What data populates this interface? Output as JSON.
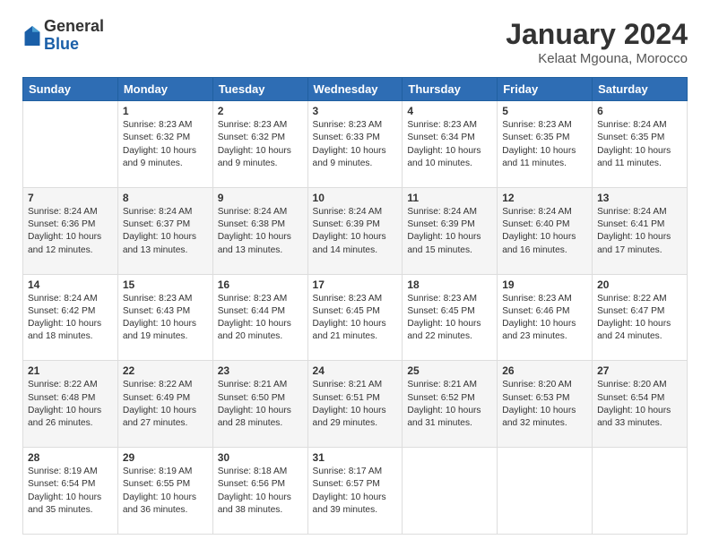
{
  "header": {
    "logo_general": "General",
    "logo_blue": "Blue",
    "month_title": "January 2024",
    "location": "Kelaat Mgouna, Morocco"
  },
  "weekdays": [
    "Sunday",
    "Monday",
    "Tuesday",
    "Wednesday",
    "Thursday",
    "Friday",
    "Saturday"
  ],
  "weeks": [
    [
      {
        "day": "",
        "info": ""
      },
      {
        "day": "1",
        "info": "Sunrise: 8:23 AM\nSunset: 6:32 PM\nDaylight: 10 hours\nand 9 minutes."
      },
      {
        "day": "2",
        "info": "Sunrise: 8:23 AM\nSunset: 6:32 PM\nDaylight: 10 hours\nand 9 minutes."
      },
      {
        "day": "3",
        "info": "Sunrise: 8:23 AM\nSunset: 6:33 PM\nDaylight: 10 hours\nand 9 minutes."
      },
      {
        "day": "4",
        "info": "Sunrise: 8:23 AM\nSunset: 6:34 PM\nDaylight: 10 hours\nand 10 minutes."
      },
      {
        "day": "5",
        "info": "Sunrise: 8:23 AM\nSunset: 6:35 PM\nDaylight: 10 hours\nand 11 minutes."
      },
      {
        "day": "6",
        "info": "Sunrise: 8:24 AM\nSunset: 6:35 PM\nDaylight: 10 hours\nand 11 minutes."
      }
    ],
    [
      {
        "day": "7",
        "info": "Sunrise: 8:24 AM\nSunset: 6:36 PM\nDaylight: 10 hours\nand 12 minutes."
      },
      {
        "day": "8",
        "info": "Sunrise: 8:24 AM\nSunset: 6:37 PM\nDaylight: 10 hours\nand 13 minutes."
      },
      {
        "day": "9",
        "info": "Sunrise: 8:24 AM\nSunset: 6:38 PM\nDaylight: 10 hours\nand 13 minutes."
      },
      {
        "day": "10",
        "info": "Sunrise: 8:24 AM\nSunset: 6:39 PM\nDaylight: 10 hours\nand 14 minutes."
      },
      {
        "day": "11",
        "info": "Sunrise: 8:24 AM\nSunset: 6:39 PM\nDaylight: 10 hours\nand 15 minutes."
      },
      {
        "day": "12",
        "info": "Sunrise: 8:24 AM\nSunset: 6:40 PM\nDaylight: 10 hours\nand 16 minutes."
      },
      {
        "day": "13",
        "info": "Sunrise: 8:24 AM\nSunset: 6:41 PM\nDaylight: 10 hours\nand 17 minutes."
      }
    ],
    [
      {
        "day": "14",
        "info": "Sunrise: 8:24 AM\nSunset: 6:42 PM\nDaylight: 10 hours\nand 18 minutes."
      },
      {
        "day": "15",
        "info": "Sunrise: 8:23 AM\nSunset: 6:43 PM\nDaylight: 10 hours\nand 19 minutes."
      },
      {
        "day": "16",
        "info": "Sunrise: 8:23 AM\nSunset: 6:44 PM\nDaylight: 10 hours\nand 20 minutes."
      },
      {
        "day": "17",
        "info": "Sunrise: 8:23 AM\nSunset: 6:45 PM\nDaylight: 10 hours\nand 21 minutes."
      },
      {
        "day": "18",
        "info": "Sunrise: 8:23 AM\nSunset: 6:45 PM\nDaylight: 10 hours\nand 22 minutes."
      },
      {
        "day": "19",
        "info": "Sunrise: 8:23 AM\nSunset: 6:46 PM\nDaylight: 10 hours\nand 23 minutes."
      },
      {
        "day": "20",
        "info": "Sunrise: 8:22 AM\nSunset: 6:47 PM\nDaylight: 10 hours\nand 24 minutes."
      }
    ],
    [
      {
        "day": "21",
        "info": "Sunrise: 8:22 AM\nSunset: 6:48 PM\nDaylight: 10 hours\nand 26 minutes."
      },
      {
        "day": "22",
        "info": "Sunrise: 8:22 AM\nSunset: 6:49 PM\nDaylight: 10 hours\nand 27 minutes."
      },
      {
        "day": "23",
        "info": "Sunrise: 8:21 AM\nSunset: 6:50 PM\nDaylight: 10 hours\nand 28 minutes."
      },
      {
        "day": "24",
        "info": "Sunrise: 8:21 AM\nSunset: 6:51 PM\nDaylight: 10 hours\nand 29 minutes."
      },
      {
        "day": "25",
        "info": "Sunrise: 8:21 AM\nSunset: 6:52 PM\nDaylight: 10 hours\nand 31 minutes."
      },
      {
        "day": "26",
        "info": "Sunrise: 8:20 AM\nSunset: 6:53 PM\nDaylight: 10 hours\nand 32 minutes."
      },
      {
        "day": "27",
        "info": "Sunrise: 8:20 AM\nSunset: 6:54 PM\nDaylight: 10 hours\nand 33 minutes."
      }
    ],
    [
      {
        "day": "28",
        "info": "Sunrise: 8:19 AM\nSunset: 6:54 PM\nDaylight: 10 hours\nand 35 minutes."
      },
      {
        "day": "29",
        "info": "Sunrise: 8:19 AM\nSunset: 6:55 PM\nDaylight: 10 hours\nand 36 minutes."
      },
      {
        "day": "30",
        "info": "Sunrise: 8:18 AM\nSunset: 6:56 PM\nDaylight: 10 hours\nand 38 minutes."
      },
      {
        "day": "31",
        "info": "Sunrise: 8:17 AM\nSunset: 6:57 PM\nDaylight: 10 hours\nand 39 minutes."
      },
      {
        "day": "",
        "info": ""
      },
      {
        "day": "",
        "info": ""
      },
      {
        "day": "",
        "info": ""
      }
    ]
  ]
}
